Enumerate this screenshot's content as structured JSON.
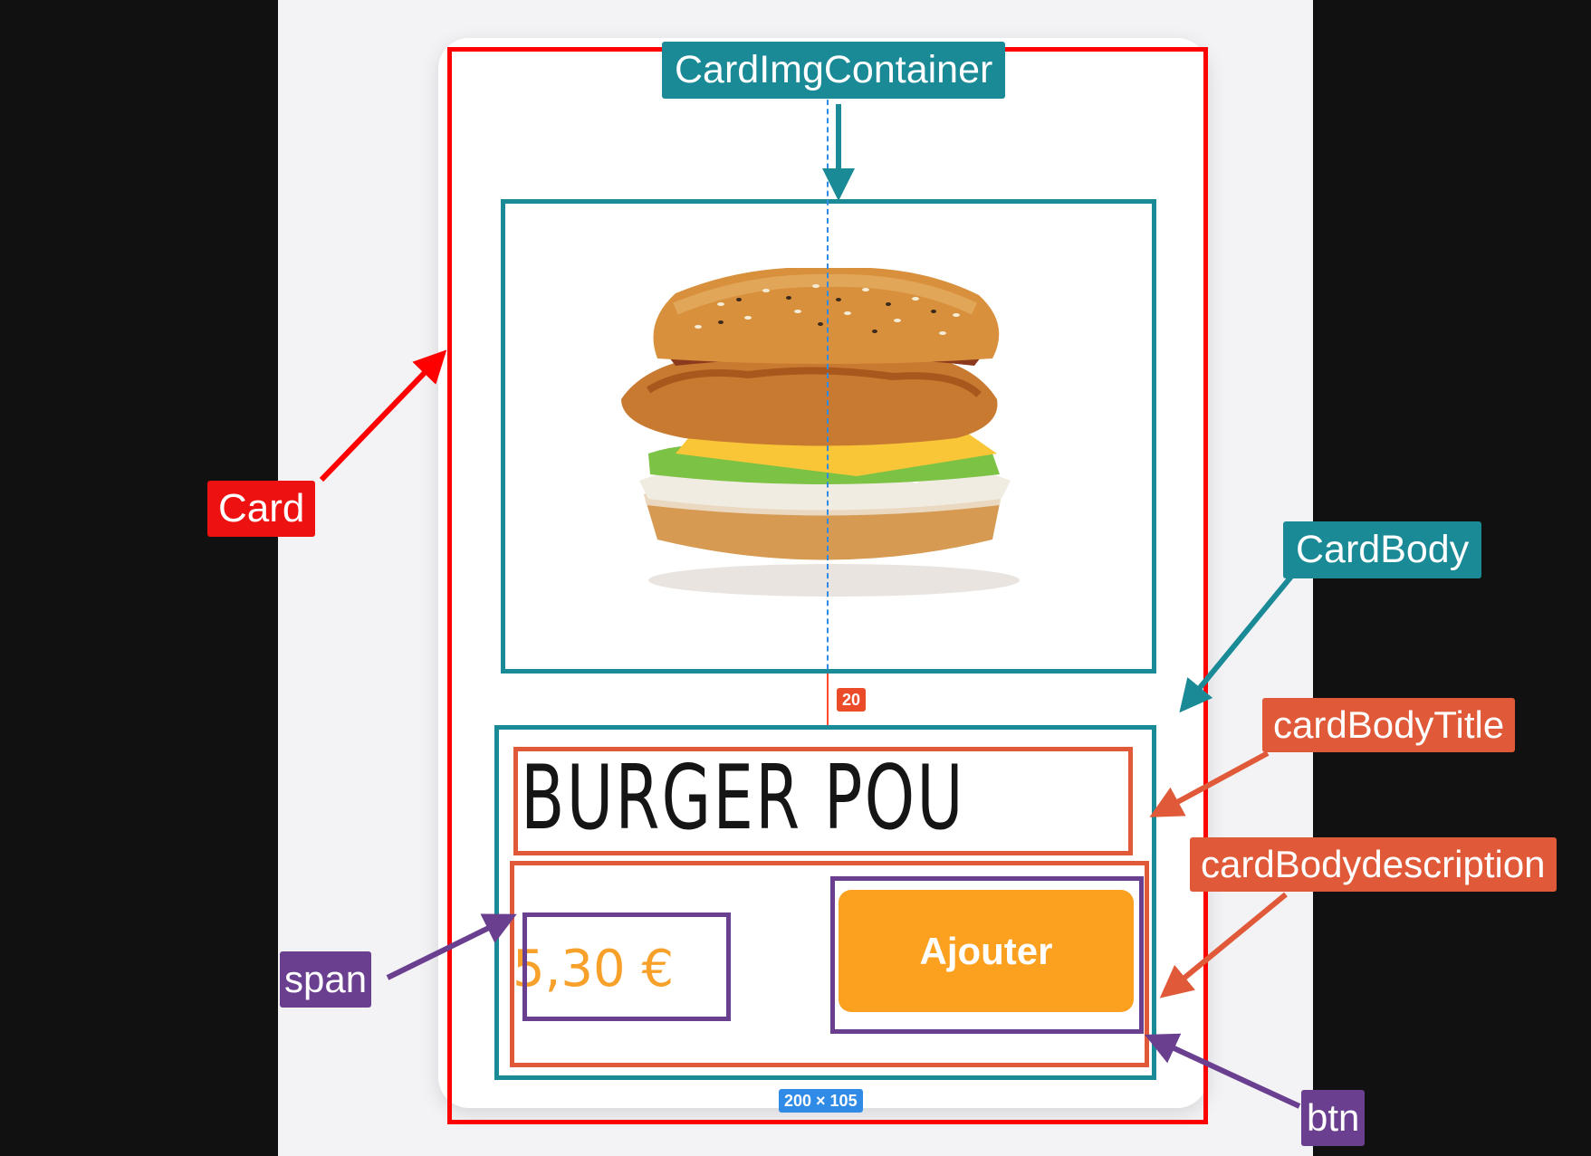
{
  "labels": {
    "card": "Card",
    "card_img_container": "CardImgContainer",
    "card_body": "CardBody",
    "card_body_title": "cardBodyTitle",
    "card_body_description": "cardBodydescription",
    "span": "span",
    "btn": "btn"
  },
  "measurements": {
    "gap": "20",
    "size": "200 × 105"
  },
  "product": {
    "title": "BURGER POULET",
    "price": "5,30 €",
    "button_label": "Ajouter"
  },
  "colors": {
    "card_outline": "#ff0000",
    "container_outline": "#1a8a96",
    "title_outline": "#e05a3a",
    "element_outline": "#6b3f8f",
    "price": "#f7a12b",
    "button": "#fba01f"
  },
  "icons": {
    "image": "burger-image"
  }
}
